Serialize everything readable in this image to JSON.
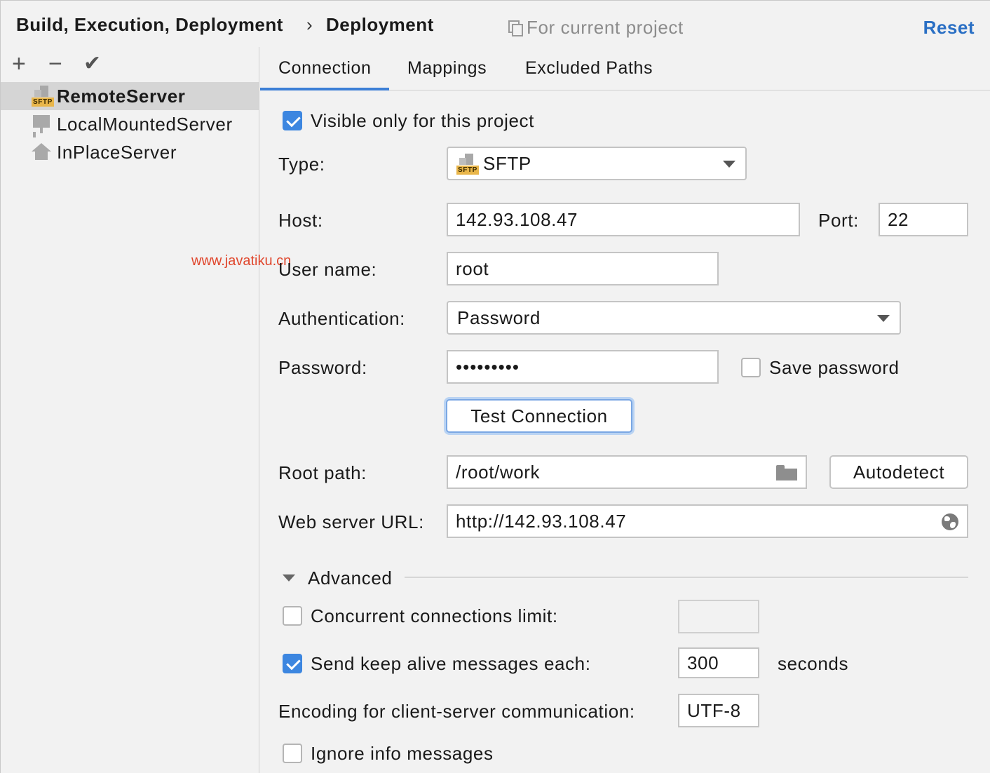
{
  "header": {
    "breadcrumb_parent": "Build, Execution, Deployment",
    "breadcrumb_separator": "›",
    "breadcrumb_current": "Deployment",
    "scope_text": "For current project",
    "reset_label": "Reset"
  },
  "sidebar": {
    "toolbar": {
      "add": "+",
      "remove": "−",
      "check": "✔"
    },
    "servers": [
      {
        "label": "RemoteServer",
        "icon": "sftp-server-icon",
        "selected": true
      },
      {
        "label": "LocalMountedServer",
        "icon": "mounted-folder-icon",
        "selected": false
      },
      {
        "label": "InPlaceServer",
        "icon": "home-icon",
        "selected": false
      }
    ],
    "sftp_tag": "SFTP"
  },
  "tabs": [
    {
      "label": "Connection",
      "active": true
    },
    {
      "label": "Mappings",
      "active": false
    },
    {
      "label": "Excluded Paths",
      "active": false
    }
  ],
  "connection": {
    "visible_only_label": "Visible only for this project",
    "visible_only_checked": true,
    "type_label": "Type:",
    "type_value": "SFTP",
    "host_label": "Host:",
    "host_value": "142.93.108.47",
    "port_label": "Port:",
    "port_value": "22",
    "username_label": "User name:",
    "username_value": "root",
    "auth_label": "Authentication:",
    "auth_value": "Password",
    "password_label": "Password:",
    "password_value": "•••••••••",
    "save_password_label": "Save password",
    "save_password_checked": false,
    "test_connection_label": "Test Connection",
    "root_path_label": "Root path:",
    "root_path_value": "/root/work",
    "autodetect_label": "Autodetect",
    "web_url_label": "Web server URL:",
    "web_url_value": "http://142.93.108.47"
  },
  "advanced": {
    "title": "Advanced",
    "concurrent_label": "Concurrent connections limit:",
    "concurrent_checked": false,
    "concurrent_value": "",
    "keep_alive_label": "Send keep alive messages each:",
    "keep_alive_checked": true,
    "keep_alive_value": "300",
    "keep_alive_unit": "seconds",
    "encoding_label": "Encoding for client-server communication:",
    "encoding_value": "UTF-8",
    "ignore_info_label": "Ignore info messages",
    "ignore_info_checked": false
  },
  "watermark": "www.javatiku.cn",
  "colors": {
    "accent": "#3c86e0",
    "link": "#2a6fc4",
    "selection": "#d5d5d5",
    "background": "#f2f2f2"
  }
}
